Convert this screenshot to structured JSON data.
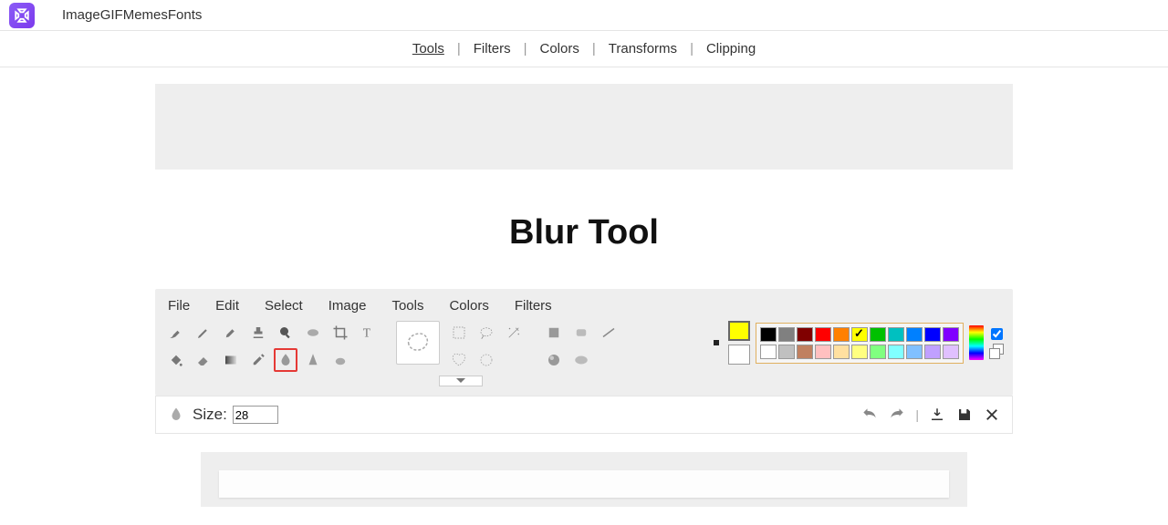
{
  "top_tabs": [
    "Image",
    "GIF",
    "Memes",
    "Fonts"
  ],
  "main_nav": [
    "Tools",
    "Filters",
    "Colors",
    "Transforms",
    "Clipping"
  ],
  "main_nav_active": 0,
  "page_title": "Blur Tool",
  "menubar": [
    "File",
    "Edit",
    "Select",
    "Image",
    "Tools",
    "Colors",
    "Filters"
  ],
  "tools_row1": [
    "brush",
    "pencil",
    "marker",
    "stamp",
    "zoom",
    "pan",
    "crop",
    "text"
  ],
  "tools_row2": [
    "fill",
    "eraser",
    "gradient",
    "picker",
    "blur",
    "sharpen",
    "smudge"
  ],
  "tool_selected": "blur",
  "selection_tools_row1": [
    "rect-select",
    "ellipse-select",
    "wand"
  ],
  "selection_tools_row2": [
    "heart-select",
    "circle-dashed",
    ""
  ],
  "shape_tools_row1": [
    "square-shape",
    "rounded-shape",
    "line-shape"
  ],
  "shape_tools_row2": [
    "sphere-shape",
    "ellipse-shape"
  ],
  "foreground_color": "#ffff00",
  "background_color": "#ffffff",
  "palette_row1": [
    {
      "c": "#000000"
    },
    {
      "c": "#808080"
    },
    {
      "c": "#800000"
    },
    {
      "c": "#ff0000"
    },
    {
      "c": "#ff8000"
    },
    {
      "c": "#ffff00",
      "check": true
    },
    {
      "c": "#00c000"
    },
    {
      "c": "#00c0c0"
    },
    {
      "c": "#0080ff"
    },
    {
      "c": "#0000ff"
    },
    {
      "c": "#8000ff"
    }
  ],
  "palette_row2": [
    {
      "c": "#ffffff"
    },
    {
      "c": "#c0c0c0"
    },
    {
      "c": "#c08060"
    },
    {
      "c": "#ffc0c0"
    },
    {
      "c": "#ffe0a0"
    },
    {
      "c": "#ffff80"
    },
    {
      "c": "#80ff80"
    },
    {
      "c": "#80ffff"
    },
    {
      "c": "#80c0ff"
    },
    {
      "c": "#c0a0ff"
    },
    {
      "c": "#e0c0ff"
    }
  ],
  "size_label": "Size:",
  "size_value": "28",
  "action_icons": [
    "undo",
    "redo",
    "download",
    "save",
    "close"
  ]
}
